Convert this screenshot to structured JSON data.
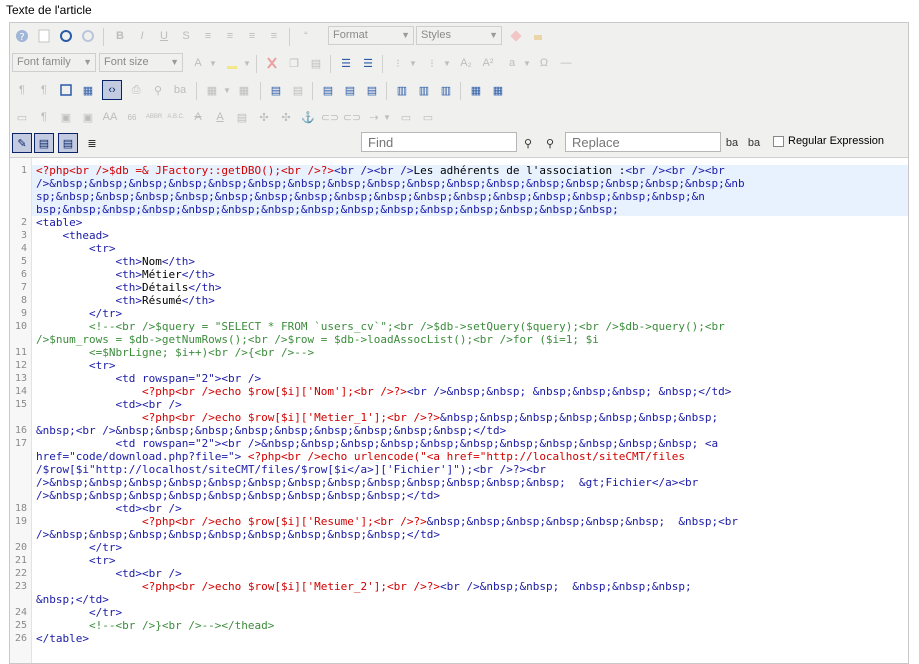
{
  "field_label": "Texte de l'article",
  "toolbar": {
    "format_label": "Format",
    "styles_label": "Styles",
    "font_family_label": "Font family",
    "font_size_label": "Font size",
    "find_placeholder": "Find",
    "replace_placeholder": "Replace",
    "regex_label": "Regular Expression"
  },
  "code": {
    "line_numbers": [
      "1",
      "2",
      "3",
      "4",
      "5",
      "6",
      "7",
      "8",
      "9",
      "10",
      "11",
      "12",
      "13",
      "14",
      "15",
      "16",
      "17",
      "18",
      "19",
      "20",
      "21",
      "22",
      "23",
      "24",
      "25",
      "26"
    ],
    "lines": [
      "<?php<br />$db =& JFactory::getDBO();<br />?><br />Les adhérents de l'association :<br /><br /><br",
      "/>&nbsp;&nbsp;&nbsp;&nbsp;&nbsp;&nbsp;&nbsp;&nbsp;&nbsp;&nbsp;&nbsp;&nbsp;&nbsp;&nbsp;&nbsp;&nbsp;&nbsp;&nb",
      "sp;&nbsp;&nbsp;&nbsp;&nbsp;&nbsp;&nbsp;&nbsp;&nbsp;&nbsp;&nbsp;&nbsp;&nbsp;&nbsp;&nbsp;&nbsp;&nbsp;&n",
      "bsp;&nbsp;&nbsp;&nbsp;&nbsp;&nbsp;&nbsp;&nbsp;&nbsp;&nbsp;&nbsp;&nbsp;&nbsp;&nbsp;&nbsp;",
      "<table>",
      "    <thead>",
      "        <tr>",
      "            <th>Nom</th>",
      "            <th>Métier</th>",
      "            <th>Détails</th>",
      "            <th>Résumé</th>",
      "        </tr>",
      "        <!--<br />$query = \"SELECT * FROM `users_cv`\";<br />$db->setQuery($query);<br />$db->query();<br",
      "/>$num_rows = $db->getNumRows();<br />$row = $db->loadAssocList();<br />for ($i=1; $i",
      "        <=$NbrLigne; $i++)<br />{<br />-->",
      "        <tr>",
      "            <td rowspan=\"2\"><br />",
      "                <?php<br />echo $row[$i]['Nom'];<br />?><br />&nbsp;&nbsp; &nbsp;&nbsp;&nbsp; &nbsp;</td>",
      "            <td><br />",
      "                <?php<br />echo $row[$i]['Metier_1'];<br />?>&nbsp;&nbsp;&nbsp;&nbsp;&nbsp;&nbsp;&nbsp;",
      "&nbsp;<br />&nbsp;&nbsp;&nbsp;&nbsp;&nbsp;&nbsp;&nbsp;&nbsp;&nbsp;</td>",
      "            <td rowspan=\"2\"><br />&nbsp;&nbsp;&nbsp;&nbsp;&nbsp;&nbsp;&nbsp;&nbsp;&nbsp;&nbsp;&nbsp; <a",
      "href=\"code/download.php?file=\"> <?php<br />echo urlencode(\"<a href=\"http://localhost/siteCMT/files",
      "/$row[$i\"http://localhost/siteCMT/files/$row[$i</a>]['Fichier']\");<br />?><br",
      "/>&nbsp;&nbsp;&nbsp;&nbsp;&nbsp;&nbsp;&nbsp;&nbsp;&nbsp;&nbsp;&nbsp;&nbsp;&nbsp;  &gt;Fichier</a><br",
      "/>&nbsp;&nbsp;&nbsp;&nbsp;&nbsp;&nbsp;&nbsp;&nbsp;&nbsp;</td>",
      "            <td><br />",
      "                <?php<br />echo $row[$i]['Resume'];<br />?>&nbsp;&nbsp;&nbsp;&nbsp;&nbsp;&nbsp;  &nbsp;<br",
      "/>&nbsp;&nbsp;&nbsp;&nbsp;&nbsp;&nbsp;&nbsp;&nbsp;&nbsp;</td>",
      "        </tr>",
      "        <tr>",
      "            <td><br />",
      "                <?php<br />echo $row[$i]['Metier_2'];<br />?><br />&nbsp;&nbsp;  &nbsp;&nbsp;&nbsp;",
      "&nbsp;</td>",
      "        </tr>",
      "        <!--<br />}<br />--></thead>",
      "</table>"
    ]
  }
}
